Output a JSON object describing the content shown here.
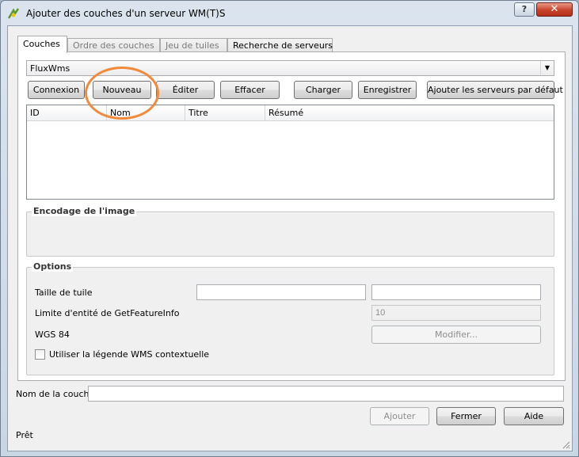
{
  "window": {
    "title": "Ajouter des couches d'un serveur WM(T)S",
    "help_label": "?",
    "close_label": "✕"
  },
  "tabs": [
    {
      "label": "Couches",
      "active": true
    },
    {
      "label": "Ordre des couches",
      "active": false
    },
    {
      "label": "Jeu de tuiles",
      "active": false
    },
    {
      "label": "Recherche de serveurs",
      "active": false
    }
  ],
  "server_combo": {
    "value": "FluxWms"
  },
  "server_buttons": {
    "connect": "Connexion",
    "new": "Nouveau",
    "edit": "Éditer",
    "delete": "Effacer",
    "load": "Charger",
    "save": "Enregistrer",
    "add_defaults": "Ajouter les serveurs par défaut"
  },
  "layer_table": {
    "columns": [
      "ID",
      "Nom",
      "Titre",
      "Résumé"
    ],
    "rows": []
  },
  "encoding": {
    "title": "Encodage de l'image"
  },
  "options": {
    "title": "Options",
    "tile_size_label": "Taille de tuile",
    "tile_width_value": "",
    "tile_height_value": "",
    "feature_limit_label": "Limite d'entité de GetFeatureInfo",
    "feature_limit_value": "10",
    "crs_label": "WGS 84",
    "change_button": "Modifier...",
    "contextual_legend_label": "Utiliser la légende WMS contextuelle",
    "contextual_legend_checked": false
  },
  "layer_name": {
    "label": "Nom de la couche",
    "value": ""
  },
  "footer_buttons": {
    "add": "Ajouter",
    "close": "Fermer",
    "help": "Aide"
  },
  "status": "Prêt",
  "colors": {
    "highlight_ring": "#f28a3a",
    "close_button": "#c7442a"
  }
}
